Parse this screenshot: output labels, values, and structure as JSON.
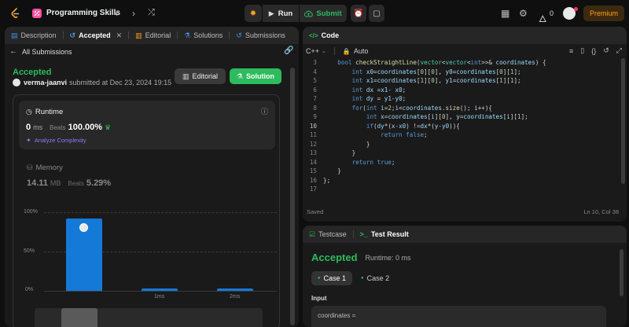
{
  "topbar": {
    "title": "Programming Skills",
    "run_label": "Run",
    "submit_label": "Submit",
    "streak_count": "0",
    "premium_label": "Premium"
  },
  "left": {
    "tabs": [
      {
        "label": "Description"
      },
      {
        "label": "Accepted"
      },
      {
        "label": "Editorial"
      },
      {
        "label": "Solutions"
      },
      {
        "label": "Submissions"
      }
    ],
    "back_label": "All Submissions",
    "status": "Accepted",
    "user": "verma-jaanvi",
    "submitted_text": "submitted at Dec 23, 2024 19:15",
    "editorial_btn": "Editorial",
    "solution_btn": "Solution",
    "runtime": {
      "title": "Runtime",
      "value": "0",
      "unit": "ms",
      "beats_label": "Beats",
      "beats_value": "100.00%",
      "analyze_label": "Analyze Complexity"
    },
    "memory": {
      "title": "Memory",
      "value": "14.11",
      "unit": "MB",
      "beats_label": "Beats",
      "beats_value": "5.29%"
    }
  },
  "chart_data": {
    "type": "bar",
    "y_ticks": [
      "100%",
      "50%",
      "0%"
    ],
    "ylim": [
      0,
      100
    ],
    "categories": [
      "",
      "1ms",
      "2ms"
    ],
    "values": [
      92,
      3,
      3
    ]
  },
  "code": {
    "title": "Code",
    "language": "C++",
    "auto_label": "Auto",
    "status": "Saved",
    "position": "Ln 10, Col 38"
  },
  "result": {
    "tab_testcase": "Testcase",
    "tab_result": "Test Result",
    "status": "Accepted",
    "runtime_text": "Runtime: 0 ms",
    "case1": "Case 1",
    "case2": "Case 2",
    "input_label": "Input",
    "input_var": "coordinates ="
  },
  "colors": {
    "accent_green": "#2cbb5d",
    "accent_orange": "#ffa116",
    "bar_blue": "#1579d8"
  }
}
